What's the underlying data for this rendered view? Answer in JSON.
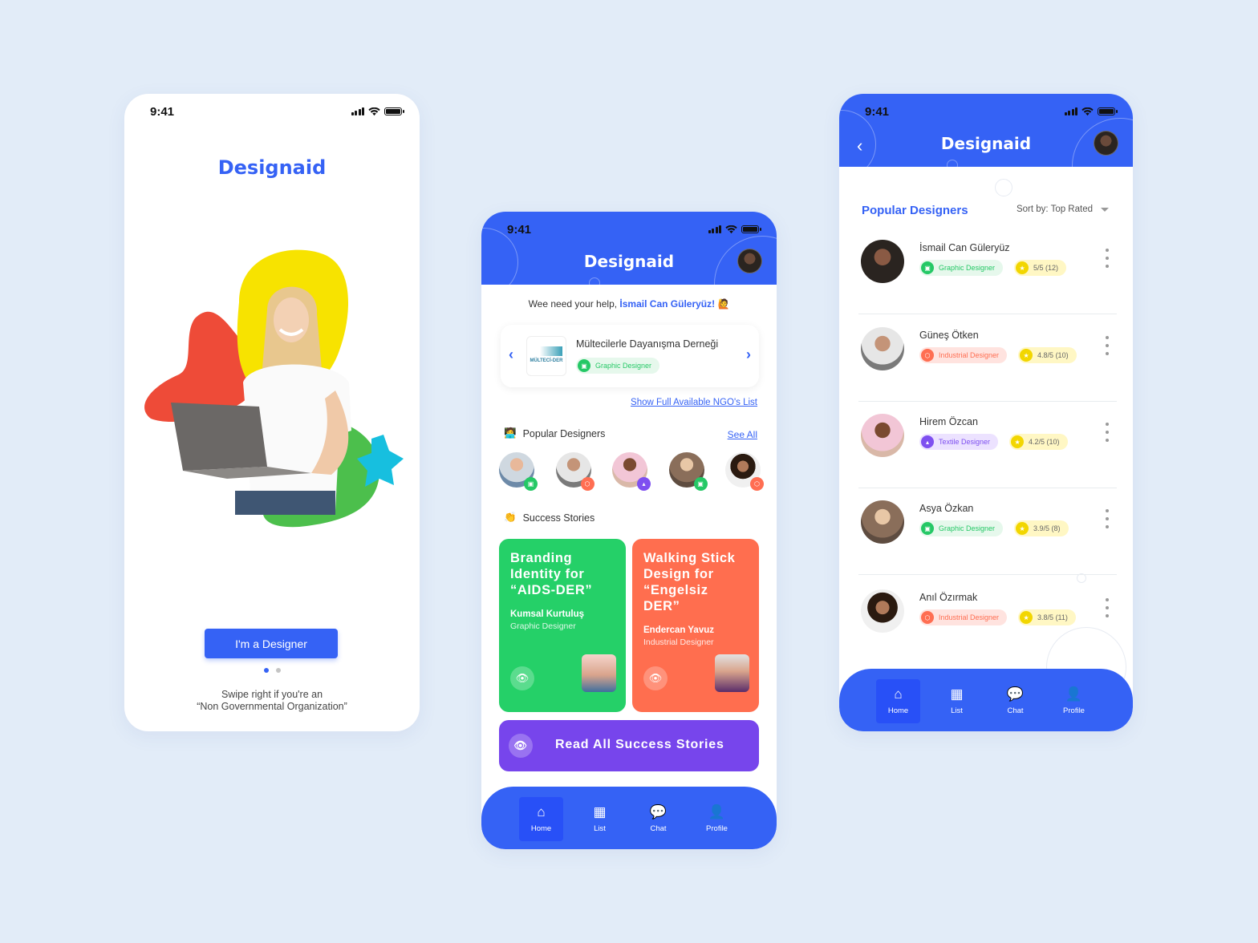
{
  "status_time": "9:41",
  "app_name": "Designaid",
  "onboarding": {
    "title": "Designaid",
    "cta_label": "I'm a Designer",
    "page_count": 2,
    "active_page": 1,
    "swipe_line1": "Swipe right if you're an",
    "swipe_line2": "“Non Governmental Organization”"
  },
  "home": {
    "title": "Designaid",
    "greeting_prefix": "Wee need your help, ",
    "greeting_name": "İsmail Can Güleryüz!",
    "greeting_emoji": "🙋",
    "ngo": {
      "name": "Mültecilerle Dayanışma Derneği",
      "logo_text": "MÜLTECİ-DER",
      "need": "Graphic Designer",
      "prev_icon": "‹",
      "next_icon": "›"
    },
    "ngo_list_link": "Show Full Available NGO's List",
    "popular_title": "Popular Designers",
    "popular_emoji": "🧑‍💻",
    "see_all": "See All",
    "popular_avatars": [
      {
        "role": "graphic",
        "badge_icon": "monitor-icon"
      },
      {
        "role": "industrial",
        "badge_icon": "cube-icon"
      },
      {
        "role": "textile",
        "badge_icon": "shirt-icon"
      },
      {
        "role": "graphic",
        "badge_icon": "monitor-icon"
      },
      {
        "role": "industrial",
        "badge_icon": "cube-icon"
      }
    ],
    "stories_title": "Success Stories",
    "stories_emoji": "👏",
    "stories": [
      {
        "title": "Branding Identity for “AIDS-DER”",
        "designer": "Kumsal Kurtuluş",
        "role": "Graphic Designer",
        "color": "#25d068"
      },
      {
        "title": "Walking Stick Design for “Engelsiz DER”",
        "designer": "Endercan Yavuz",
        "role": "Industrial Designer",
        "color": "#ff6e4f"
      }
    ],
    "read_all": "Read All Success Stories"
  },
  "list_screen": {
    "title": "Designaid",
    "section_title": "Popular Designers",
    "sort_label": "Sort by: Top Rated",
    "designers": [
      {
        "name": "İsmail Can Güleryüz",
        "role": "Graphic Designer",
        "type": "g",
        "rating": "5/5 (12)"
      },
      {
        "name": "Güneş Ötken",
        "role": "Industrial Designer",
        "type": "r",
        "rating": "4.8/5 (10)"
      },
      {
        "name": "Hirem Özcan",
        "role": "Textile Designer",
        "type": "p",
        "rating": "4.2/5 (10)"
      },
      {
        "name": "Asya Özkan",
        "role": "Graphic Designer",
        "type": "g",
        "rating": "3.9/5 (8)"
      },
      {
        "name": "Anıl Özırmak",
        "role": "Industrial Designer",
        "type": "r",
        "rating": "3.8/5 (11)"
      }
    ]
  },
  "nav": [
    {
      "label": "Home",
      "icon": "home-icon",
      "active": true
    },
    {
      "label": "List",
      "icon": "list-icon",
      "active": false
    },
    {
      "label": "Chat",
      "icon": "chat-icon",
      "active": false
    },
    {
      "label": "Profile",
      "icon": "profile-icon",
      "active": false
    }
  ],
  "colors": {
    "primary": "#3562f5",
    "background": "#e2ecf8",
    "green": "#25c866",
    "coral": "#ff6e52",
    "purple": "#7745ec",
    "yellow": "#f2d600"
  }
}
